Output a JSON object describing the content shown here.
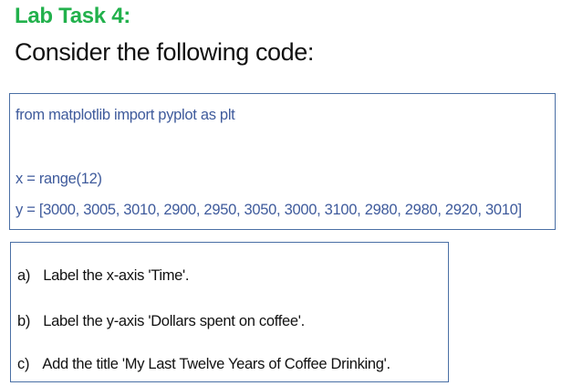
{
  "heading": {
    "title": "Lab Task 4:",
    "subtitle": "Consider the following code:"
  },
  "code": {
    "lines": [
      "from matplotlib import pyplot as plt",
      "x = range(12)",
      "y = [3000, 3005, 3010, 2900, 2950, 3050, 3000, 3100, 2980, 2980, 2920, 3010]"
    ]
  },
  "tasks": [
    {
      "marker": "a)",
      "text": "Label the x-axis 'Time'."
    },
    {
      "marker": "b)",
      "text": "Label the y-axis 'Dollars spent on coffee'."
    },
    {
      "marker": "c)",
      "text": "Add the title 'My Last Twelve Years of Coffee Drinking'."
    }
  ],
  "colors": {
    "title": "#22b14c",
    "code_text": "#3f5b9c",
    "box_border": "#4a6fa5"
  }
}
